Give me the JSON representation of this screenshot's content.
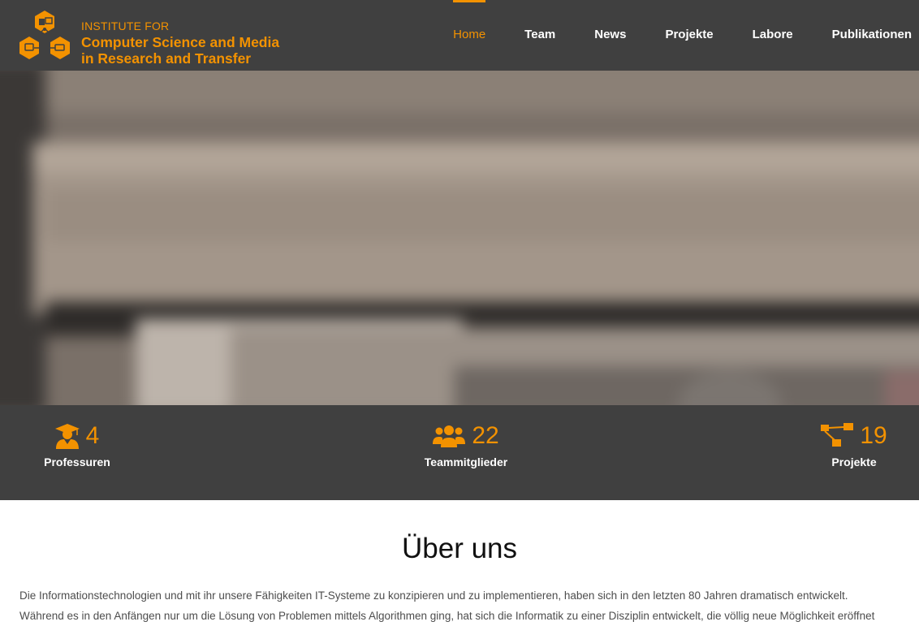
{
  "header": {
    "logo_line1": "INSTITUTE FOR",
    "logo_line2": "Computer Science and Media",
    "logo_line3": "in Research and Transfer",
    "logo_icon": "hexagon-network-logo"
  },
  "nav": {
    "items": [
      {
        "label": "Home",
        "active": true
      },
      {
        "label": "Team",
        "active": false
      },
      {
        "label": "News",
        "active": false
      },
      {
        "label": "Projekte",
        "active": false
      },
      {
        "label": "Labore",
        "active": false
      },
      {
        "label": "Publikationen",
        "active": false
      }
    ]
  },
  "stats": [
    {
      "icon": "graduate-icon",
      "value": "4",
      "label": "Professuren"
    },
    {
      "icon": "users-icon",
      "value": "22",
      "label": "Teammitglieder"
    },
    {
      "icon": "project-tree-icon",
      "value": "19",
      "label": "Projekte"
    }
  ],
  "about": {
    "title": "Über uns",
    "line1": "Die Informationstechnologien und mit ihr unsere Fähigkeiten IT-Systeme zu konzipieren und zu implementieren, haben sich in den letzten 80 Jahren dramatisch entwickelt.",
    "line2": "Während es in den Anfängen nur um die Lösung von Problemen mittels Algorithmen ging, hat sich die Informatik zu einer Disziplin entwickelt, die völlig neue Möglichkeit eröffnet"
  },
  "colors": {
    "accent": "#f39200",
    "dark": "#404040",
    "text": "#4d4d4d"
  }
}
